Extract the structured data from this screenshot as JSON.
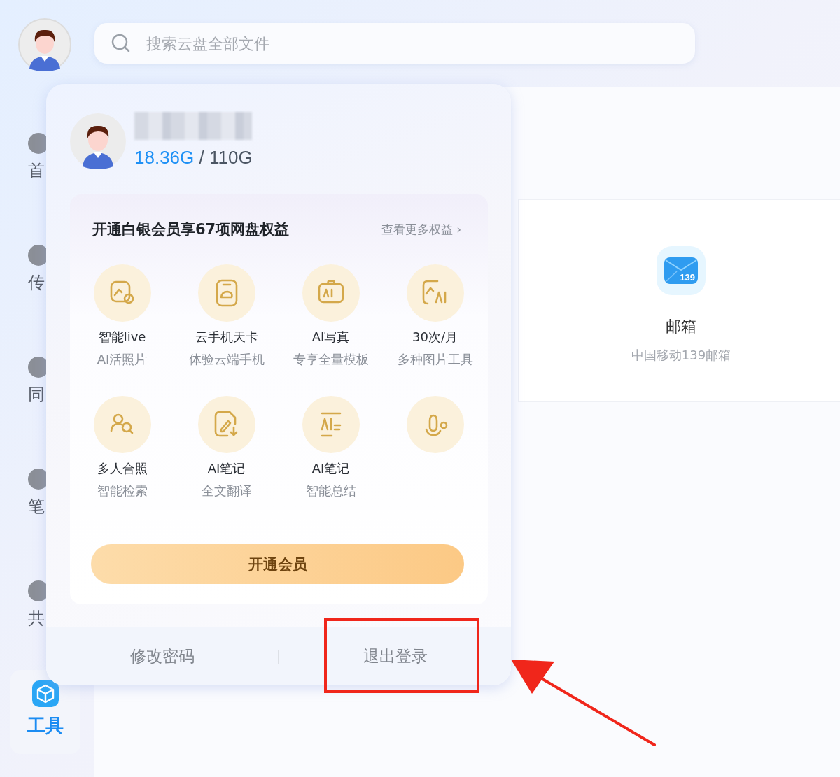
{
  "search": {
    "placeholder": "搜索云盘全部文件"
  },
  "sidebar": {
    "items": [
      {
        "label": "首",
        "selected": false
      },
      {
        "label": "传",
        "selected": false
      },
      {
        "label": "同",
        "selected": false
      },
      {
        "label": "笔",
        "selected": false
      },
      {
        "label": "共",
        "selected": false
      },
      {
        "label": "工具",
        "selected": true
      }
    ]
  },
  "tool_card": {
    "title": "邮箱",
    "subtitle": "中国移动139邮箱",
    "icon_text": "139"
  },
  "account_popup": {
    "storage": {
      "used": "18.36G",
      "total": "/ 110G"
    },
    "membership": {
      "title": "开通白银会员享67项网盘权益",
      "more_link": "查看更多权益",
      "more_arrow": "›",
      "benefits": [
        {
          "kind": "labeled",
          "title": "智能live",
          "subtitle": "AI活照片"
        },
        {
          "kind": "labeled",
          "title": "云手机天卡",
          "subtitle": "体验云端手机"
        },
        {
          "kind": "labeled",
          "title": "AI写真",
          "subtitle": "专享全量模板"
        },
        {
          "kind": "labeled",
          "title": "30次/月",
          "subtitle": "多种图片工具"
        },
        {
          "kind": "labeled",
          "title": "多人合照",
          "subtitle": "智能检索"
        },
        {
          "kind": "labeled",
          "title": "AI笔记",
          "subtitle": "全文翻译"
        },
        {
          "kind": "labeled",
          "title": "AI笔记",
          "subtitle": "智能总结"
        },
        {
          "kind": "icon_only"
        }
      ],
      "button": "开通会员"
    },
    "footer": {
      "buttons": [
        "修改密码",
        "退出登录"
      ]
    }
  }
}
